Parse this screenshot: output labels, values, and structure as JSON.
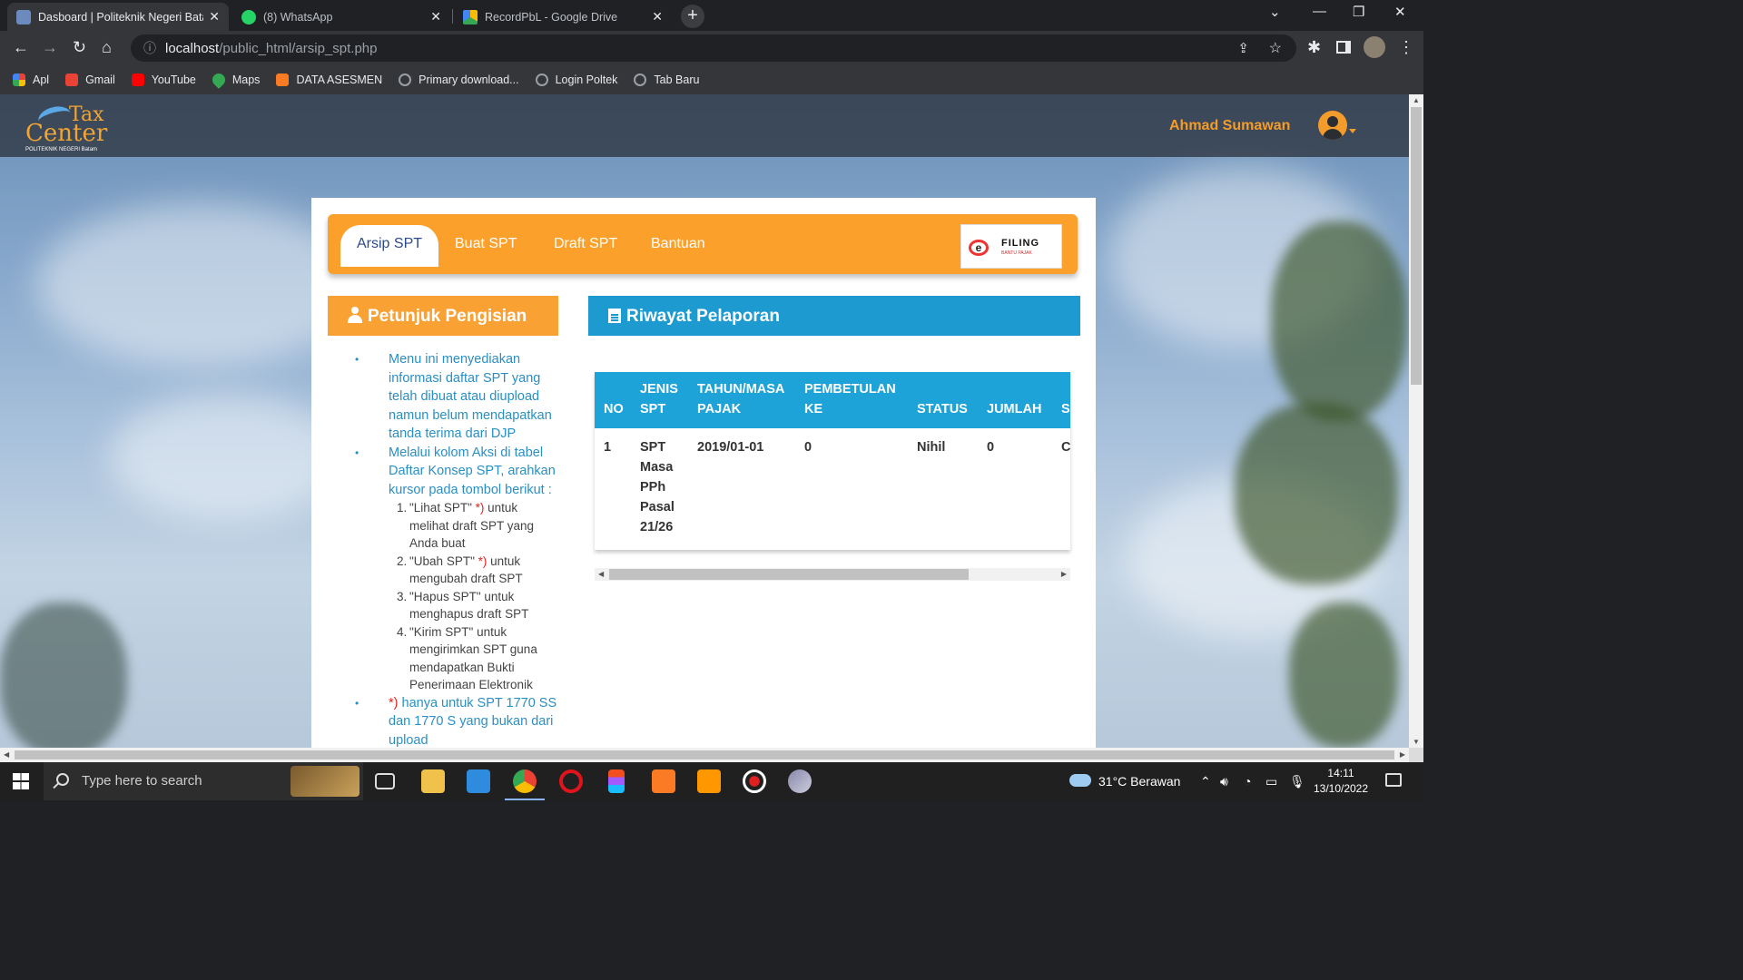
{
  "browser": {
    "tabs": [
      {
        "label": "Dasboard | Politeknik Negeri Batam",
        "active": true
      },
      {
        "label": "(8) WhatsApp",
        "active": false
      },
      {
        "label": "RecordPbL - Google Drive",
        "active": false
      }
    ],
    "url_host": "localhost",
    "url_path": "/public_html/arsip_spt.php",
    "bookmarks": [
      {
        "label": "Apl",
        "icon": "apps-grid-icon"
      },
      {
        "label": "Gmail",
        "icon": "gmail-icon"
      },
      {
        "label": "YouTube",
        "icon": "youtube-icon"
      },
      {
        "label": "Maps",
        "icon": "maps-icon"
      },
      {
        "label": "DATA ASESMEN",
        "icon": "xampp-icon"
      },
      {
        "label": "Primary download...",
        "icon": "globe-icon"
      },
      {
        "label": "Login Poltek",
        "icon": "globe-icon"
      },
      {
        "label": "Tab Baru",
        "icon": "globe-icon"
      }
    ]
  },
  "site": {
    "logo_line1": "Tax",
    "logo_line2": "Center",
    "logo_sub": "POLITEKNIK NEGERI Batam",
    "user_name": "Ahmad Sumawan",
    "accent": "#f39c2b"
  },
  "nav": {
    "tabs": [
      "Arsip SPT",
      "Buat SPT",
      "Draft SPT",
      "Bantuan"
    ],
    "efiling_title": "FILING",
    "efiling_sub": "BANTU PAJAK"
  },
  "guide": {
    "title": "Petunjuk Pengisian",
    "item1": "Menu ini menyediakan informasi daftar SPT yang telah dibuat atau diupload namun belum mendapatkan tanda terima dari DJP",
    "item2": "Melalui kolom Aksi di tabel Daftar Konsep SPT, arahkan kursor pada tombol berikut :",
    "steps": [
      {
        "pre": "\"Lihat SPT\" ",
        "star": "*)",
        "post": " untuk melihat draft SPT yang Anda buat"
      },
      {
        "pre": "\"Ubah SPT\" ",
        "star": "*)",
        "post": " untuk mengubah draft SPT"
      },
      {
        "pre": "\"Hapus SPT\" untuk menghapus draft SPT",
        "star": "",
        "post": ""
      },
      {
        "pre": "\"Kirim SPT\" untuk mengirimkan SPT guna mendapatkan Bukti Penerimaan Elektronik",
        "star": "",
        "post": ""
      }
    ],
    "item3_star": "*)",
    "item3": " hanya untuk SPT 1770 SS dan 1770 S yang bukan dari upload"
  },
  "history": {
    "title": "Riwayat Pelaporan",
    "headers": [
      "NO",
      "JENIS SPT",
      "TAHUN/MASA PAJAK",
      "PEMBETULAN KE",
      "STATUS",
      "JUMLAH",
      "S"
    ],
    "rows": [
      [
        "1",
        "SPT Masa PPh Pasal 21/26",
        "2019/01-01",
        "0",
        "Nihil",
        "0",
        "C"
      ]
    ]
  },
  "taskbar": {
    "search_placeholder": "Type here to search",
    "weather": "31°C  Berawan",
    "time": "14:11",
    "date": "13/10/2022"
  }
}
